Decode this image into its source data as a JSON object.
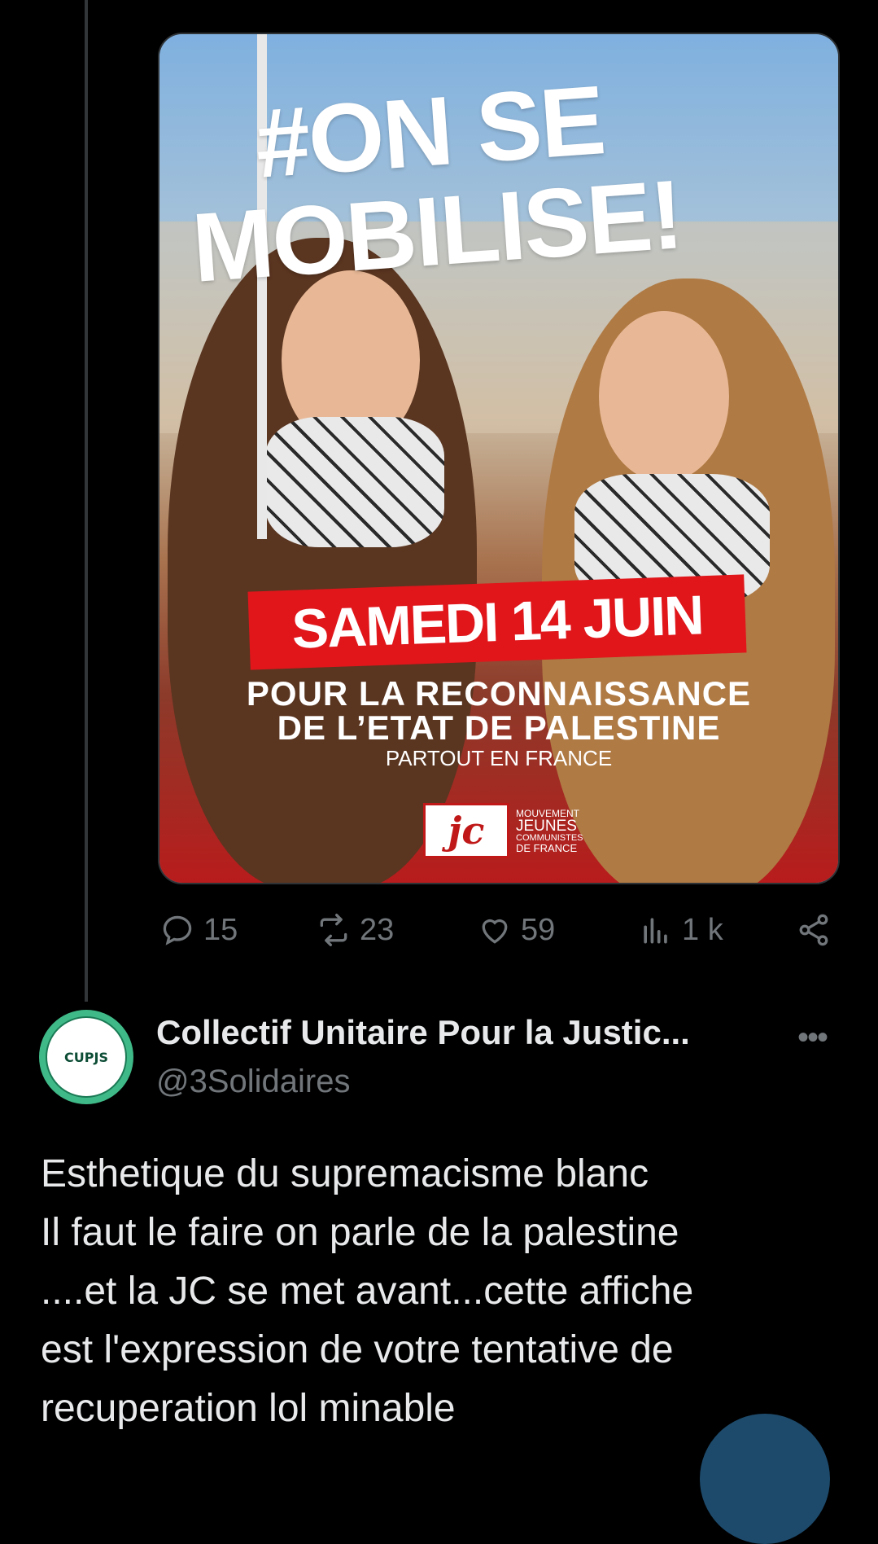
{
  "post": {
    "media": {
      "headline_line1": "#ON SE",
      "headline_line2": "MOBILISE!",
      "date_banner": "SAMEDI 14 JUIN",
      "subtitle_line1": "POUR LA RECONNAISSANCE",
      "subtitle_line2": "DE L’ETAT DE PALESTINE",
      "subtitle_line3": "PARTOUT EN FRANCE",
      "logo_mark": "jc",
      "logo_text": [
        "MOUVEMENT",
        "JEUNES",
        "COMMUNISTES",
        "DE FRANCE"
      ]
    },
    "actions": {
      "replies": "15",
      "reposts": "23",
      "likes": "59",
      "views": "1 k"
    }
  },
  "reply": {
    "avatar_text": "CUPJS",
    "display_name": "Collectif Unitaire Pour la Justic...",
    "handle": "@3Solidaires",
    "more_icon": "more-horizontal-icon",
    "text_lines": [
      "Esthetique du supremacisme blanc",
      "Il faut le faire on parle de la palestine",
      "....et la JC se met avant...cette affiche",
      "est l'expression de votre tentative de",
      "recuperation lol minable"
    ]
  },
  "colors": {
    "background": "#000000",
    "text_primary": "#e7e9ea",
    "text_secondary": "#71767b",
    "banner_red": "#e0161b",
    "avatar_green": "#3fb987"
  }
}
